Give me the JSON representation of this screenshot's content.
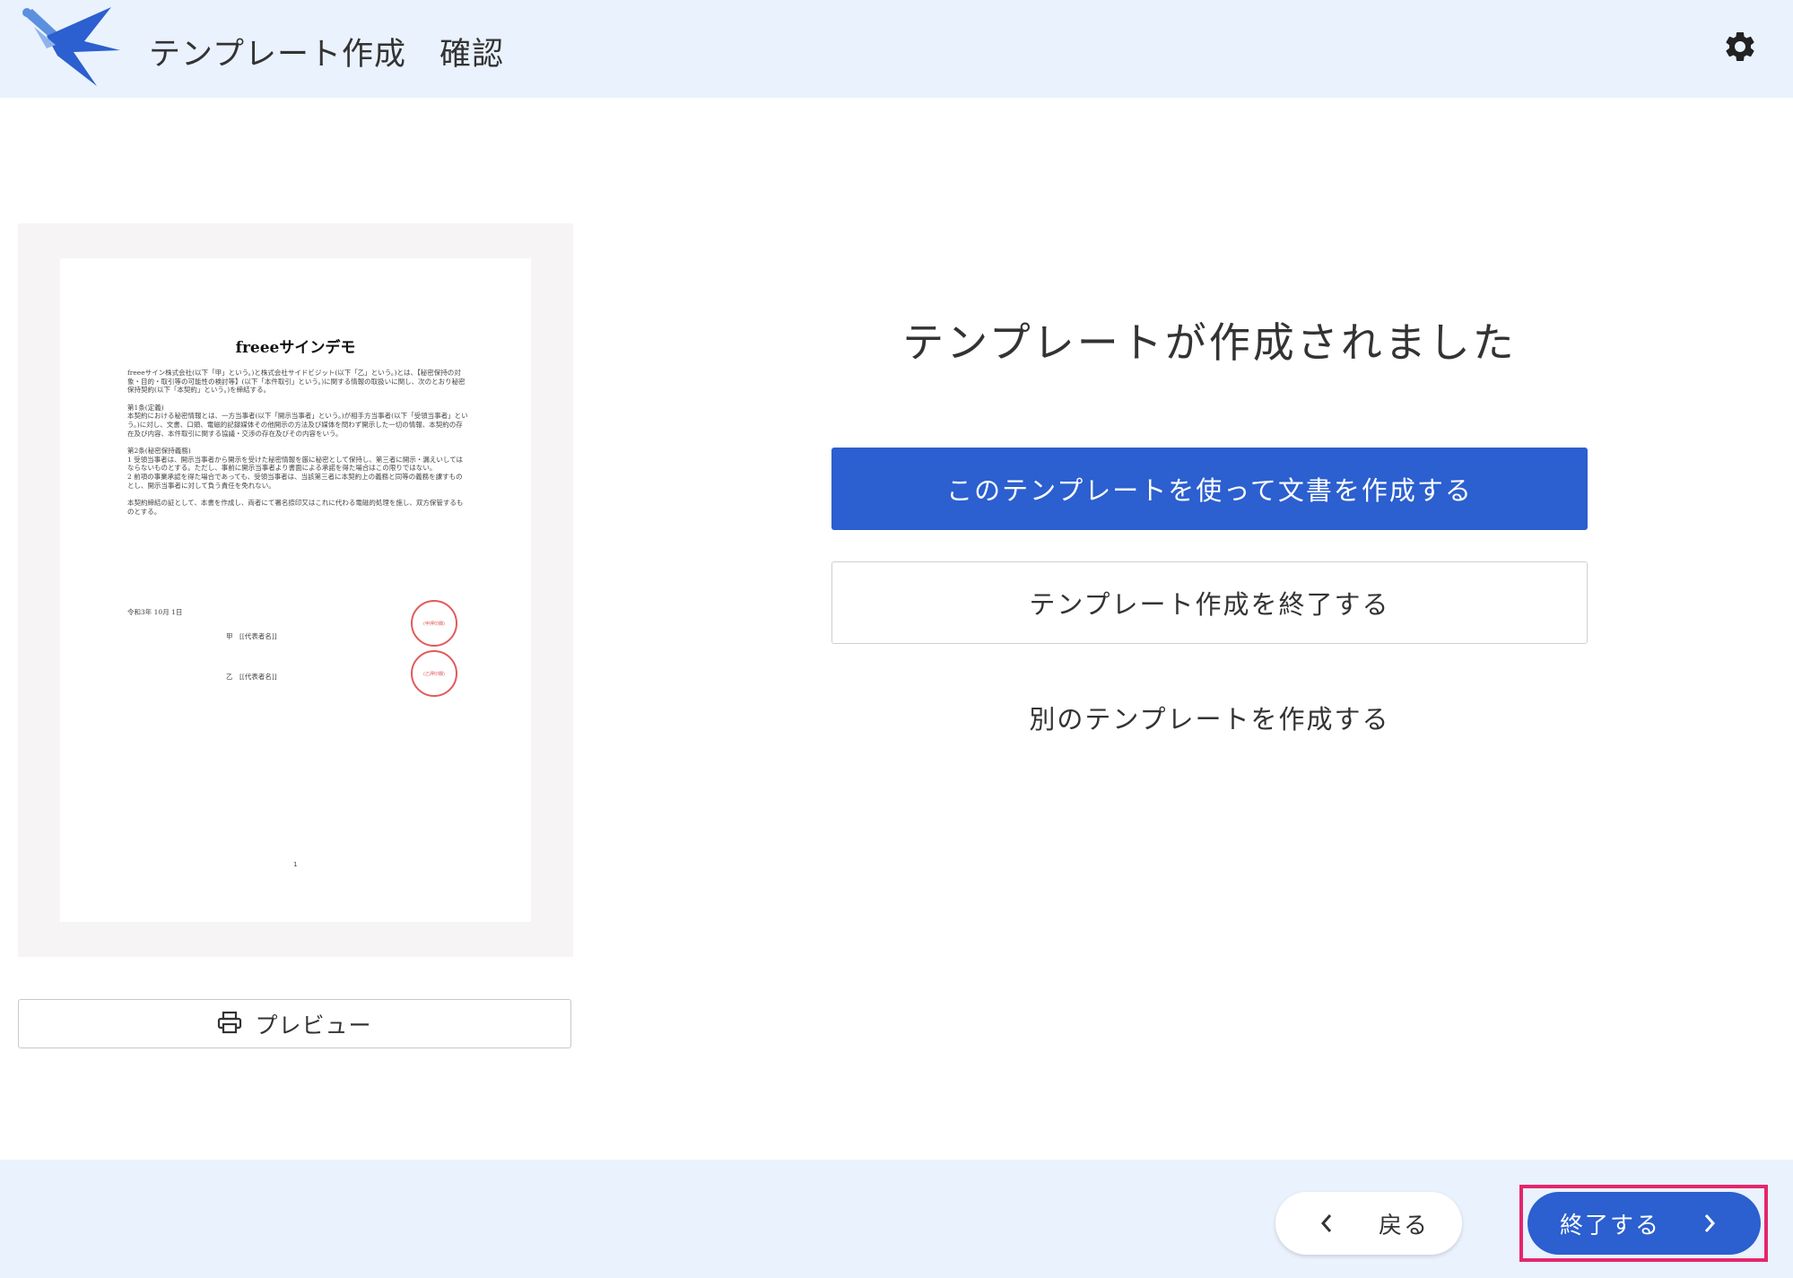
{
  "header": {
    "title": "テンプレート作成",
    "step": "確認"
  },
  "preview": {
    "document": {
      "title": "freeeサインデモ",
      "intro": "freeeサイン株式会社(以下「甲」という。)と株式会社サイドビジット(以下「乙」という。)とは、【秘密保持の対象・目的・取引等の可能性の検討等】(以下「本件取引」という。)に関する情報の取扱いに関し、次のとおり秘密保持契約(以下「本契約」という。)を締結する。",
      "art1_heading": "第1条(定義)",
      "art1_body": "本契約における秘密情報とは、一方当事者(以下「開示当事者」という。)が相手方当事者(以下「受領当事者」という。)に対し、文書、口頭、電磁的記録媒体その他開示の方法及び媒体を問わず開示した一切の情報、本契約の存在及び内容、本件取引に関する協議・交渉の存在及びその内容をいう。",
      "art2_heading": "第2条(秘密保持義務)",
      "art2_body1": "1 受領当事者は、開示当事者から開示を受けた秘密情報を厳に秘密として保持し、第三者に開示・漏えいしてはならないものとする。ただし、事前に開示当事者より書面による承諾を得た場合はこの限りではない。",
      "art2_body2": "2 前項の事業承認を得た場合であっても、受領当事者は、当該第三者に本契約上の義務と同等の義務を課すものとし、開示当事者に対して負う責任を免れない。",
      "closing": "本契約締結の証として、本書を作成し、両者にて署名捺印又はこれに代わる電磁的処理を施し、双方保管するものとする。",
      "date": "令和3年 10月 1日",
      "party_a": "甲　[[代表者名]]",
      "party_b": "乙　[[代表者名]]",
      "seal_a": "(甲押印欄)",
      "seal_b": "(乙押印欄)",
      "page_number": "1"
    },
    "button_label": "プレビュー",
    "button_icon": "printer-icon"
  },
  "result": {
    "title": "テンプレートが作成されました",
    "primary_button": "このテンプレートを使って文書を作成する",
    "secondary_button": "テンプレート作成を終了する",
    "text_button": "別のテンプレートを作成する"
  },
  "footer": {
    "back_label": "戻る",
    "finish_label": "終了する"
  },
  "colors": {
    "header_bg": "#eaf2fd",
    "primary": "#2c5fcf",
    "highlight": "#e5266b",
    "seal": "#e25a5a"
  }
}
